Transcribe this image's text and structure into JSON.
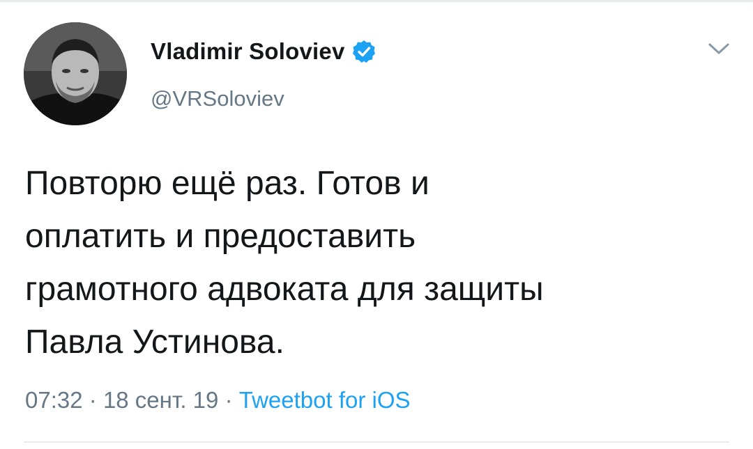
{
  "author": {
    "display_name": "Vladimir Soloviev",
    "handle": "@VRSoloviev",
    "verified_icon": "verified-badge-icon",
    "avatar_icon": "profile-photo"
  },
  "tweet": {
    "lines": [
      "Повторю ещё раз. Готов и",
      "оплатить и предоставить",
      "грамотного адвоката для защиты",
      "Павла Устинова."
    ]
  },
  "meta": {
    "time": "07:32",
    "separator": "·",
    "date": "18 сент. 19",
    "source": "Tweetbot for iOS"
  },
  "menu_icon": "chevron-down-icon",
  "colors": {
    "text": "#14171a",
    "secondary": "#657786",
    "link": "#1da1f2",
    "divider": "#e6ecf0"
  }
}
